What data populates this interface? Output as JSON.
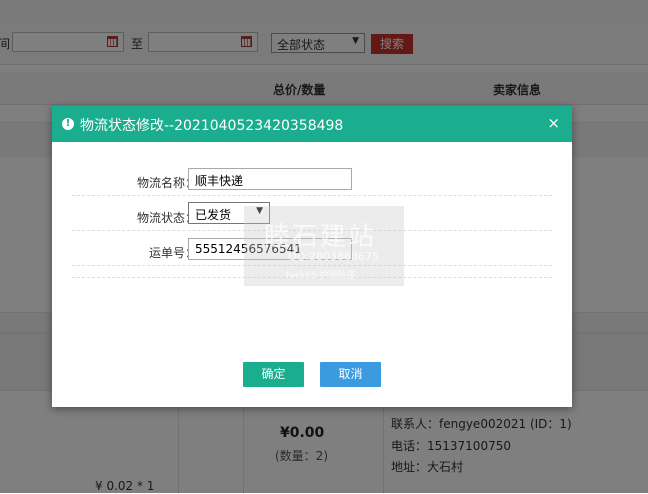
{
  "filters": {
    "date_label_partial": "间",
    "to_label": "至",
    "status_select": "全部状态",
    "search_label": "搜索"
  },
  "table": {
    "col_total": "总价/数量",
    "col_seller": "卖家信息"
  },
  "order": {
    "price": "¥0.00",
    "quantity": "(数量：2)",
    "unit_price": "¥ 0.02 * 1",
    "seller_contact": "联系人：fengye002021 (ID：1)",
    "seller_phone": "电话：15137100750",
    "seller_address": "地址：大石村"
  },
  "dialog": {
    "title": "物流状态修改--2021040523420358498",
    "close_symbol": "×",
    "fields": {
      "logistics_name_label": "物流名称：",
      "logistics_name_value": "顺丰快递",
      "logistics_status_label": "物流状态：",
      "logistics_status_value": "已发货",
      "tracking_label": "运单号：",
      "tracking_value": "55512456576541"
    },
    "confirm_label": "确定",
    "cancel_label": "取消"
  },
  "watermark": {
    "line1": "睦石建站",
    "line2": "QQ:2803868675",
    "line3": "fuck65 护理防盗"
  },
  "colors": {
    "dialog_header": "#1aad8e",
    "confirm_button": "#1aad8e",
    "cancel_button": "#3a9be0",
    "search_button": "#c9302c"
  },
  "icons": {
    "dialog_title_icon": "info-circle-icon",
    "close": "close-icon",
    "date": "calendar-icon",
    "select_arrow": "chevron-down-icon"
  }
}
